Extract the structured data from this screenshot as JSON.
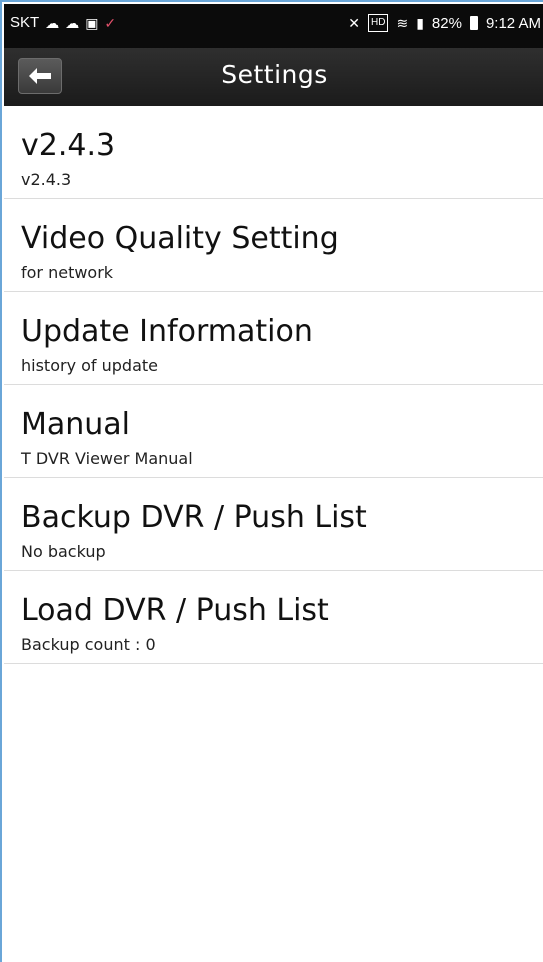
{
  "status_bar": {
    "carrier": "SKT",
    "battery": "82%",
    "time": "9:12 AM"
  },
  "title_bar": {
    "title": "Settings"
  },
  "settings": [
    {
      "title": "v2.4.3",
      "subtitle": "v2.4.3"
    },
    {
      "title": "Video Quality Setting",
      "subtitle": "for network"
    },
    {
      "title": "Update Information",
      "subtitle": "history of update"
    },
    {
      "title": "Manual",
      "subtitle": "T DVR Viewer Manual"
    },
    {
      "title": "Backup DVR / Push List",
      "subtitle": "No backup"
    },
    {
      "title": "Load DVR / Push List",
      "subtitle": "Backup count : 0"
    }
  ],
  "colors": {
    "status_bar": "#0b0b0b",
    "title_bar": "#2a2a2a",
    "background": "#ffffff",
    "divider": "#dcdcdc"
  }
}
